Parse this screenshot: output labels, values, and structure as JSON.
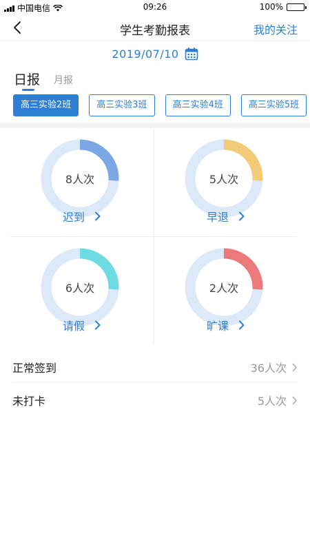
{
  "status_bar": {
    "carrier": "中国电信",
    "time": "09:26",
    "battery": "100%",
    "battery_level": 1.0,
    "icons": [
      "signal-icon",
      "wifi-icon",
      "battery-icon"
    ]
  },
  "nav": {
    "back_icon": "back-chevron-icon",
    "title": "学生考勤报表",
    "follow": "我的关注"
  },
  "date": {
    "value": "2019/07/10",
    "icon": "calendar-icon"
  },
  "tabs": [
    {
      "label": "日报",
      "active": true
    },
    {
      "label": "月报",
      "active": false
    }
  ],
  "classes": [
    {
      "label": "高三实验2班",
      "active": true
    },
    {
      "label": "高三实验3班",
      "active": false
    },
    {
      "label": "高三实验4班",
      "active": false
    },
    {
      "label": "高三实验5班",
      "active": false
    }
  ],
  "stats": [
    {
      "count": "8人次",
      "label": "迟到",
      "fraction": 0.26,
      "color": "#7ba7e4"
    },
    {
      "count": "5人次",
      "label": "早退",
      "fraction": 0.26,
      "color": "#f3cb78"
    },
    {
      "count": "6人次",
      "label": "请假",
      "fraction": 0.26,
      "color": "#6edbe2"
    },
    {
      "count": "2人次",
      "label": "旷课",
      "fraction": 0.26,
      "color": "#ec7a7d"
    }
  ],
  "ring_track_color": "#dce9f8",
  "accent_color": "#2d7fd3",
  "summary": [
    {
      "label": "正常签到",
      "value": "36人次"
    },
    {
      "label": "未打卡",
      "value": "5人次"
    }
  ]
}
